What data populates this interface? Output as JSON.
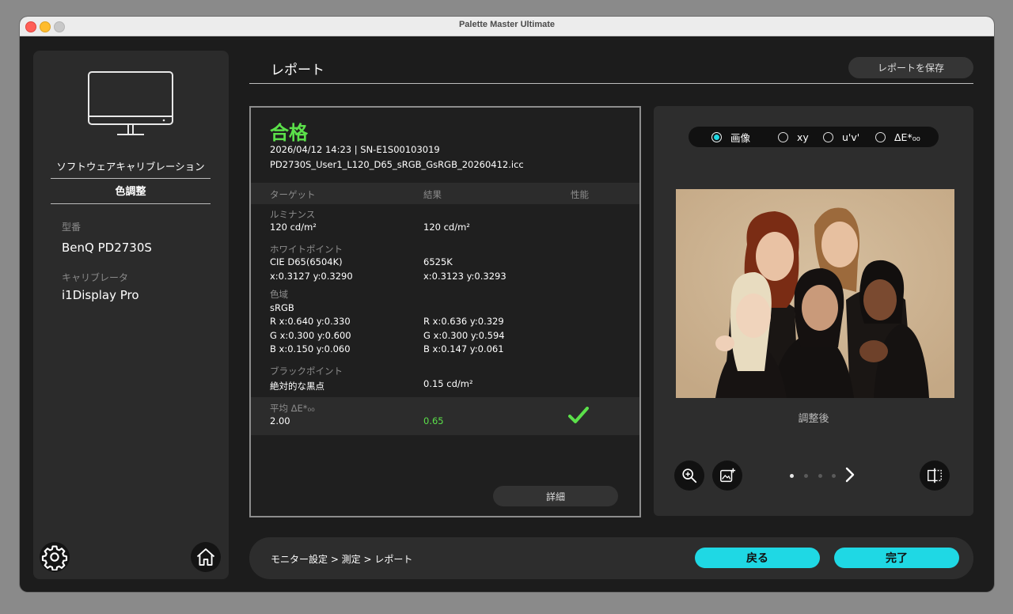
{
  "window": {
    "title": "Palette Master Ultimate"
  },
  "sidebar": {
    "mode": "ソフトウェアキャリブレーション",
    "active_item": "色調整",
    "model_label": "型番",
    "model_value": "BenQ PD2730S",
    "calibrator_label": "キャリブレータ",
    "calibrator_value": "i1Display Pro"
  },
  "header": {
    "title": "レポート",
    "save_label": "レポートを保存"
  },
  "report": {
    "status": "合格",
    "date_serial": "2026/04/12 14:23 | SN-E1S00103019",
    "profile": "PD2730S_User1_L120_D65_sRGB_GsRGB_20260412.icc",
    "columns": [
      "ターゲット",
      "結果",
      "性能"
    ],
    "luminance": {
      "label": "ルミナンス",
      "target": "120 cd/m²",
      "result": "120 cd/m²"
    },
    "whitepoint": {
      "label": "ホワイトポイント",
      "target1": "CIE D65(6504K)",
      "result1": "6525K",
      "target2": "x:0.3127 y:0.3290",
      "result2": "x:0.3123 y:0.3293"
    },
    "gamut": {
      "label": "色域",
      "name": "sRGB",
      "r_target": "R x:0.640 y:0.330",
      "r_result": "R x:0.636 y:0.329",
      "g_target": "G x:0.300 y:0.600",
      "g_result": "G x:0.300 y:0.594",
      "b_target": "B x:0.150 y:0.060",
      "b_result": "B x:0.147 y:0.061"
    },
    "blackpoint": {
      "label": "ブラックポイント",
      "target": "絶対的な黒点",
      "result": "0.15 cd/m²"
    },
    "avg_delta": {
      "label": "平均 ΔE*₀₀",
      "target": "2.00",
      "result": "0.65"
    },
    "detail_label": "詳細"
  },
  "preview": {
    "options": [
      "画像",
      "xy",
      "u'v'",
      "ΔE*₀₀"
    ],
    "selected": 0,
    "caption": "調整後"
  },
  "footer": {
    "crumbs": "モニター設定 >  測定 >  レポート",
    "back_label": "戻る",
    "done_label": "完了"
  },
  "colors": {
    "accent": "#1fd8e4",
    "pass": "#5be04a",
    "background": "#1c1c1c"
  }
}
